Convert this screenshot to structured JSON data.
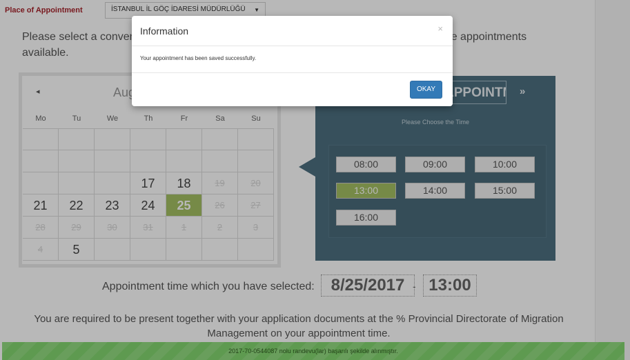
{
  "place": {
    "label": "Place of Appointment",
    "selected": "İSTANBUL İL GÖÇ İDARESİ MÜDÜRLÜĞÜ",
    "caret": "▼"
  },
  "intro_text": "Please select a convenient date and time. Dates and times are arranged according to the appointments available.",
  "calendar": {
    "prev": "◂",
    "month": "August 2017",
    "days_of_week": [
      "Mo",
      "Tu",
      "We",
      "Th",
      "Fr",
      "Sa",
      "Su"
    ],
    "weeks": [
      [
        "",
        "",
        "",
        "",
        "",
        "",
        ""
      ],
      [
        "",
        "",
        "",
        "",
        "",
        "",
        ""
      ],
      [
        "",
        "",
        "",
        "17",
        "18",
        "19",
        "20"
      ],
      [
        "21",
        "22",
        "23",
        "24",
        "25",
        "26",
        "27"
      ],
      [
        "28",
        "29",
        "30",
        "31",
        "1",
        "2",
        "3"
      ],
      [
        "4",
        "5",
        "",
        "",
        "",
        "",
        ""
      ]
    ],
    "selected_day": "25"
  },
  "time_panel": {
    "day_label": "APPOINTMENT DAY",
    "next": "»",
    "subtitle": "Please Choose the Time",
    "slots": [
      "08:00",
      "09:00",
      "10:00",
      "13:00",
      "14:00",
      "15:00",
      "16:00"
    ],
    "selected_slot": "13:00"
  },
  "selection": {
    "label": "Appointment time which you have selected:",
    "date": "8/25/2017",
    "separator": "-",
    "time": "13:00"
  },
  "required_text": "You are required to be present together with your application documents at the % Provincial Directorate of Migration Management on your appointment time.",
  "status_text": "2017-70-0544087 nolu randevu(lar) başarılı şekilde alınmıştır.",
  "modal": {
    "title": "Information",
    "close": "×",
    "message": "Your appointment has been saved successfully.",
    "ok_label": "OKAY"
  },
  "colors": {
    "accent_green": "#a4bf63",
    "panel_blue": "#4d6f80",
    "button_blue": "#337ab7",
    "status_green": "#83d66f"
  }
}
